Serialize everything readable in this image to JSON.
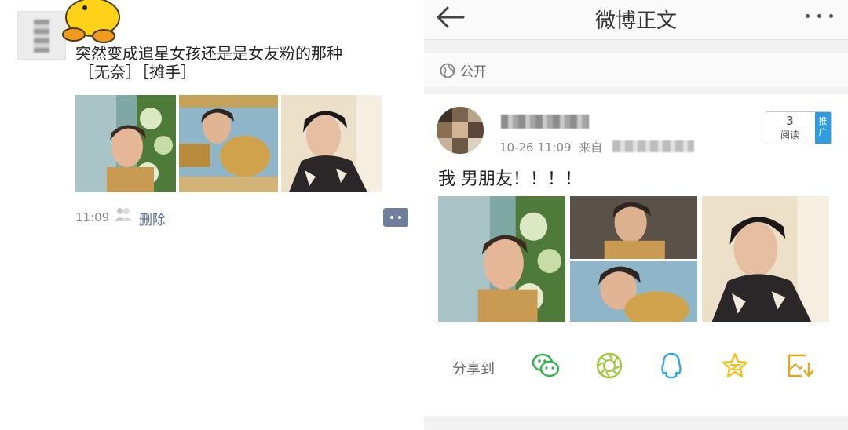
{
  "moments_post": {
    "text": "突然变成追星女孩还是是女友粉的那种",
    "emoji_text": "［无奈］［摊手］",
    "time": "11:09",
    "delete_label": "删除"
  },
  "weibo": {
    "title": "微博正文",
    "visibility": "公开",
    "post": {
      "timestamp": "10-26 11:09",
      "source_prefix": "来自",
      "body": "我  男朋友！！！！"
    },
    "read_box": {
      "count": "3",
      "label": "阅读",
      "promote": "推广"
    },
    "share": {
      "label": "分享到",
      "targets": [
        "wechat-icon",
        "moments-icon",
        "qq-icon",
        "qzone-icon",
        "save-image-icon"
      ]
    }
  },
  "colors": {
    "link": "#5b6b8c",
    "promote": "#2f9ce0",
    "wechat": "#2fb34a",
    "moments": "#9bc93a",
    "qq": "#33a6e8",
    "qzone": "#f2c01b",
    "save": "#e6a51a"
  }
}
